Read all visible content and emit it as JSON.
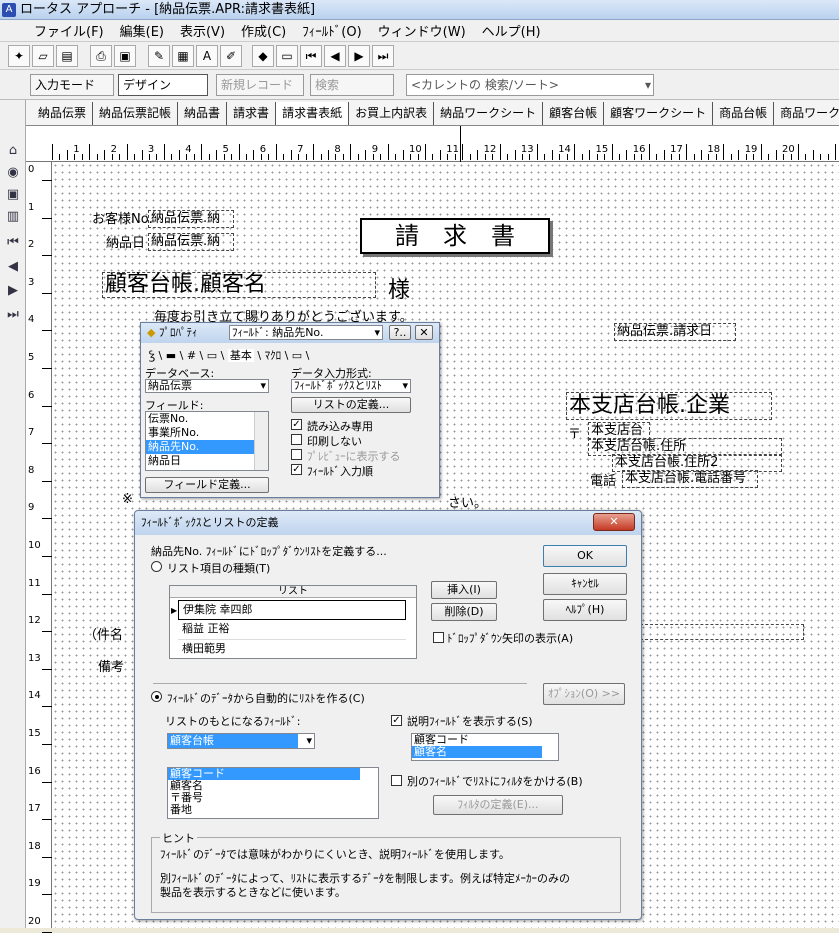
{
  "window": {
    "title": "ロータス アプローチ - [納品伝票.APR:請求書表紙]",
    "app_icon": "approach-icon"
  },
  "menu": [
    "ファイル(F)",
    "編集(E)",
    "表示(V)",
    "作成(C)",
    "ﾌｨｰﾙﾄﾞ(O)",
    "ウィンドウ(W)",
    "ヘルプ(H)"
  ],
  "toolbar2": {
    "input_mode": "入力モード",
    "design": "デザイン",
    "new_record": "新規レコード",
    "search": "検索",
    "search_combo": "<カレントの 検索/ソート>"
  },
  "tabs": [
    "納品伝票",
    "納品伝票記帳",
    "納品書",
    "請求書",
    "請求書表紙",
    "お買上内訳表",
    "納品ワークシート",
    "顧客台帳",
    "顧客ワークシート",
    "商品台帳",
    "商品ワークシ"
  ],
  "ruler": {
    "h": [
      "1",
      "2",
      "3",
      "4",
      "5",
      "6",
      "7",
      "8",
      "9",
      "10",
      "11",
      "12",
      "13",
      "14",
      "15",
      "16",
      "17",
      "18",
      "19",
      "20"
    ],
    "v": [
      "0",
      "1",
      "2",
      "3",
      "4",
      "5",
      "6",
      "7",
      "8",
      "9",
      "10",
      "11",
      "12",
      "13",
      "14",
      "15",
      "16",
      "17",
      "18",
      "19",
      "20"
    ]
  },
  "form": {
    "customer_no_label": "お客様No.",
    "customer_no_field": "納品伝票.納",
    "delivery_date_label": "納品日",
    "delivery_date_field": "納品伝票.納",
    "doc_title": "請　求　書",
    "customer_name_field": "顧客台帳.顧客名",
    "sama": "様",
    "greeting": "毎度お引き立て賜りありがとうございます。",
    "billing_date_field": "納品伝票.請求日",
    "company_field": "本支店台帳.企業",
    "postal_mark": "〒",
    "postal_field": "本支店台",
    "address_field": "本支店台帳.住所",
    "address2_field": "本支店台帳.住所2",
    "tel_label": "電話",
    "tel_field": "本支店台帳.電話番号",
    "asterisk": "※",
    "text_fragment": "さい。",
    "subject_label": "（件名",
    "remarks_label": "備考"
  },
  "props": {
    "title": "ﾌﾟﾛﾊﾟﾃｨ",
    "field_combo": "ﾌｨｰﾙﾄﾞ: 納品先No.",
    "tabs": [
      "基本",
      "ﾏｸﾛ"
    ],
    "db_label": "データベース:",
    "db_value": "納品伝票",
    "field_label": "フィールド:",
    "fields": [
      "伝票No.",
      "事業所No.",
      "納品先No.",
      "納品日"
    ],
    "selected_index": 2,
    "input_format_label": "データ入力形式:",
    "input_format_value": "ﾌｨｰﾙﾄﾞﾎﾞｯｸｽとﾘｽﾄ",
    "list_def_btn": "リストの定義...",
    "field_def_btn": "フィールド定義...",
    "checks": [
      {
        "label": "読み込み専用",
        "checked": true,
        "disabled": false
      },
      {
        "label": "印刷しない",
        "checked": false,
        "disabled": false
      },
      {
        "label": "ﾌﾟﾚﾋﾞｭｰに表示する",
        "checked": false,
        "disabled": true
      },
      {
        "label": "ﾌｨｰﾙﾄﾞ入力順",
        "checked": true,
        "disabled": false
      }
    ]
  },
  "dialog": {
    "title": "ﾌｨｰﾙﾄﾞﾎﾞｯｸｽとリストの定義",
    "intro": "納品先No. ﾌｨｰﾙﾄﾞにﾄﾞﾛｯﾌﾟﾀﾞｳﾝﾘｽﾄを定義する...",
    "radio1": "リスト項目の種類(T)",
    "list_header": "リスト",
    "list_items": [
      "伊集院 幸四郎",
      "稲益 正裕",
      "横田範男"
    ],
    "insert_btn": "挿入(I)",
    "delete_btn": "削除(D)",
    "dropdown_arrow_check": "ﾄﾞﾛｯﾌﾟﾀﾞｳﾝ矢印の表示(A)",
    "ok": "OK",
    "cancel": "ｷｬﾝｾﾙ",
    "help": "ﾍﾙﾌﾟ(H)",
    "radio2": "ﾌｨｰﾙﾄﾞのﾃﾞｰﾀから自動的にﾘｽﾄを作る(C)",
    "options_btn": "ｵﾌﾟｼｮﾝ(O) >>",
    "source_field_label": "リストのもとになるﾌｨｰﾙﾄﾞ:",
    "source_db": "顧客台帳",
    "source_fields": [
      "顧客コード",
      "顧客名",
      "〒番号",
      "番地"
    ],
    "show_desc_check": "説明ﾌｨｰﾙﾄﾞを表示する(S)",
    "desc_fields": [
      "顧客コード",
      "顧客名"
    ],
    "filter_check": "別のﾌｨｰﾙﾄﾞでﾘｽﾄにﾌｨﾙﾀをかける(B)",
    "filter_btn": "ﾌｨﾙﾀの定義(E)...",
    "hint_title": "ヒント",
    "hint1": "ﾌｨｰﾙﾄﾞのﾃﾞｰﾀでは意味がわかりにくいとき、説明ﾌｨｰﾙﾄﾞを使用します。",
    "hint2": "別ﾌｨｰﾙﾄﾞのﾃﾞｰﾀによって、ﾘｽﾄに表示するﾃﾞｰﾀを制限します。例えば特定ﾒｰｶｰのみの",
    "hint3": "製品を表示するときなどに使います。"
  }
}
